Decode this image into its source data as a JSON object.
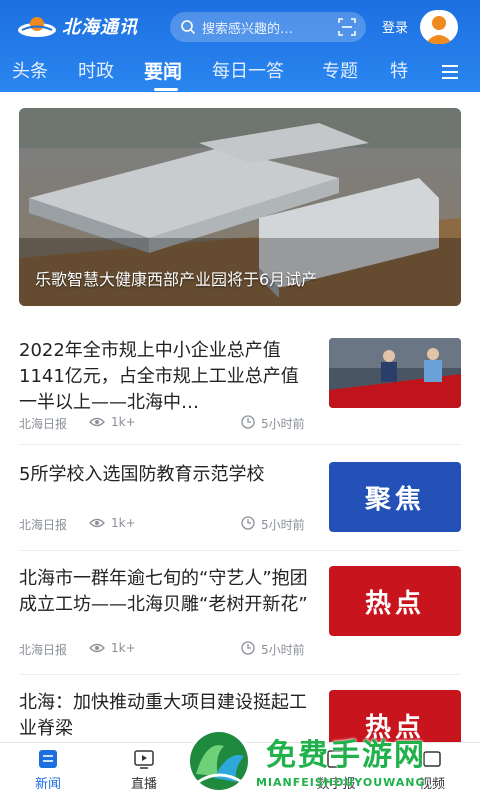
{
  "header": {
    "logo_text": "北海通讯",
    "search_placeholder": "搜索感兴趣的…",
    "login_label": "登录"
  },
  "tabs": [
    {
      "label": "头条"
    },
    {
      "label": "时政"
    },
    {
      "label": "要闻"
    },
    {
      "label": "每日一答"
    },
    {
      "label": "专题"
    },
    {
      "label": "特"
    }
  ],
  "active_tab": "要闻",
  "hero": {
    "caption": "乐歌智慧大健康西部产业园将于6月试产"
  },
  "articles": [
    {
      "title": "2022年全市规上中小企业总产值1141亿元，占全市规上工业总产值一半以上——北海中…",
      "source": "北海日报",
      "views": "1k+",
      "time": "5小时前",
      "thumb_label": ""
    },
    {
      "title": "5所学校入选国防教育示范学校",
      "source": "北海日报",
      "views": "1k+",
      "time": "5小时前",
      "thumb_label": "聚焦"
    },
    {
      "title": "北海市一群年逾七旬的“守艺人”抱团成立工坊——北海贝雕“老树开新花”",
      "source": "北海日报",
      "views": "1k+",
      "time": "5小时前",
      "thumb_label": "热点"
    },
    {
      "title": "北海：加快推动重大项目建设挺起工业脊梁",
      "source": "",
      "views": "",
      "time": "",
      "thumb_label": "热点"
    }
  ],
  "bottom_nav": [
    {
      "label": "新闻"
    },
    {
      "label": "直播"
    },
    {
      "label": "数字报"
    },
    {
      "label": "视频"
    }
  ],
  "watermark": {
    "text": "免费手游网",
    "sub": "MIANFEISHOUYOUWANG"
  },
  "colors": {
    "header_blue": "#1d6fe0",
    "focus_blue": "#2451b8",
    "hot_red": "#c8141c",
    "watermark_green": "#21b14b"
  }
}
